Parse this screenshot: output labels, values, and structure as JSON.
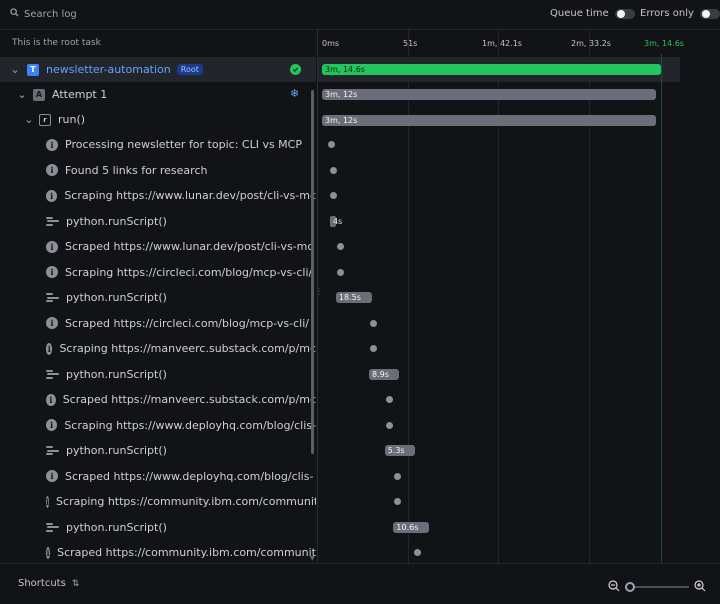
{
  "search": {
    "placeholder": "Search log"
  },
  "toggles": [
    {
      "label": "Queue time",
      "on": false
    },
    {
      "label": "Errors only",
      "on": false
    }
  ],
  "tree": {
    "header": "This is the root task",
    "root": {
      "name": "newsletter-automation",
      "tag": "Root",
      "badge": "T",
      "status": "success"
    },
    "attempt": {
      "name": "Attempt 1",
      "badge": "A"
    },
    "run": {
      "name": "run()"
    },
    "events": [
      {
        "type": "info",
        "label": "Processing newsletter for topic: CLI vs MCP"
      },
      {
        "type": "info",
        "label": "Found 5 links for research"
      },
      {
        "type": "info",
        "label": "Scraping https://www.lunar.dev/post/cli-vs-mc"
      },
      {
        "type": "script",
        "label": "python.runScript()"
      },
      {
        "type": "info",
        "label": "Scraped https://www.lunar.dev/post/cli-vs-mc"
      },
      {
        "type": "info",
        "label": "Scraping https://circleci.com/blog/mcp-vs-cli/"
      },
      {
        "type": "script",
        "label": "python.runScript()"
      },
      {
        "type": "info",
        "label": "Scraped https://circleci.com/blog/mcp-vs-cli/"
      },
      {
        "type": "info",
        "label": "Scraping https://manveerc.substack.com/p/mc"
      },
      {
        "type": "script",
        "label": "python.runScript()"
      },
      {
        "type": "info",
        "label": "Scraped https://manveerc.substack.com/p/mc"
      },
      {
        "type": "info",
        "label": "Scraping https://www.deployhq.com/blog/clis-"
      },
      {
        "type": "script",
        "label": "python.runScript()"
      },
      {
        "type": "info",
        "label": "Scraped https://www.deployhq.com/blog/clis-"
      },
      {
        "type": "info",
        "label": "Scraping https://community.ibm.com/communit"
      },
      {
        "type": "script",
        "label": "python.runScript()"
      },
      {
        "type": "info",
        "label": "Scraped https://community.ibm.com/communit"
      }
    ]
  },
  "timeline": {
    "ticks": [
      "0ms",
      "51s",
      "1m, 42.1s",
      "2m, 33.2s",
      "3m, 14.6s"
    ],
    "end_tick_color": "#22c55e",
    "root_bar": {
      "label": "3m, 14.6s",
      "start_s": 0,
      "duration_s": 194.6,
      "color": "#22c55e"
    },
    "attempt_bar": {
      "label": "3m, 12s",
      "start_s": 0,
      "duration_s": 192
    },
    "run_bar": {
      "label": "3m, 12s",
      "start_s": 0,
      "duration_s": 192
    },
    "event_marks": [
      {
        "kind": "dot",
        "at_s": 3
      },
      {
        "kind": "dot",
        "at_s": 4
      },
      {
        "kind": "dot",
        "at_s": 4
      },
      {
        "kind": "bar",
        "at_s": 4,
        "label": "4s"
      },
      {
        "kind": "dot",
        "at_s": 8
      },
      {
        "kind": "dot",
        "at_s": 8
      },
      {
        "kind": "bar",
        "at_s": 8,
        "label": "18.5s"
      },
      {
        "kind": "dot",
        "at_s": 27
      },
      {
        "kind": "dot",
        "at_s": 27
      },
      {
        "kind": "bar",
        "at_s": 27,
        "label": "8.9s"
      },
      {
        "kind": "dot",
        "at_s": 36
      },
      {
        "kind": "dot",
        "at_s": 36
      },
      {
        "kind": "bar",
        "at_s": 36,
        "label": "5.3s"
      },
      {
        "kind": "dot",
        "at_s": 41
      },
      {
        "kind": "dot",
        "at_s": 41
      },
      {
        "kind": "bar",
        "at_s": 41,
        "label": "10.6s"
      },
      {
        "kind": "dot",
        "at_s": 52
      }
    ]
  },
  "footer": {
    "shortcuts_label": "Shortcuts",
    "zoom_level": 0
  }
}
